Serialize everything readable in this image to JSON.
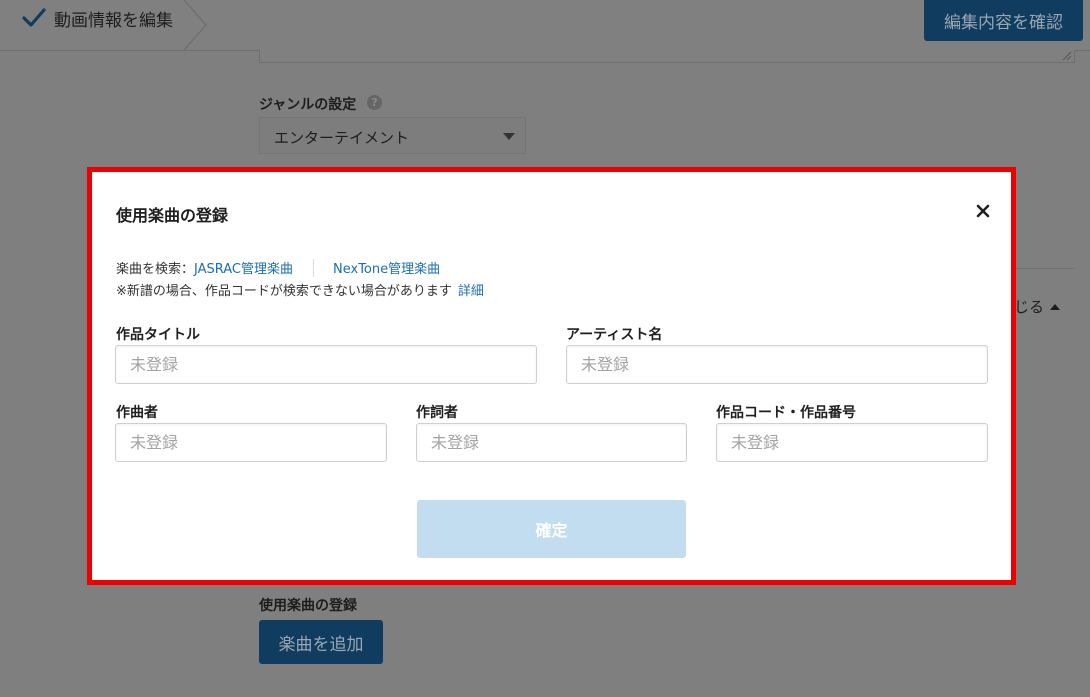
{
  "header": {
    "breadcrumb_label": "動画情報を編集",
    "confirm_button_label": "編集内容を確認"
  },
  "page": {
    "genre_label": "ジャンルの設定",
    "genre_help": "?",
    "genre_value": "エンターテイメント",
    "collapse_toggle_label": "じる",
    "music_section_label": "使用楽曲の登録",
    "add_music_button_label": "楽曲を追加"
  },
  "modal": {
    "title": "使用楽曲の登録",
    "search_prefix": "楽曲を検索：",
    "jasrac_link": "JASRAC管理楽曲",
    "nextone_link": "NexTone管理楽曲",
    "note_text": "※新譜の場合、作品コードが検索できない場合があります",
    "detail_link": "詳細",
    "fields": {
      "title": {
        "label": "作品タイトル",
        "placeholder": "未登録",
        "value": ""
      },
      "artist": {
        "label": "アーティスト名",
        "placeholder": "未登録",
        "value": ""
      },
      "composer": {
        "label": "作曲者",
        "placeholder": "未登録",
        "value": ""
      },
      "lyricist": {
        "label": "作詞者",
        "placeholder": "未登録",
        "value": ""
      },
      "work_code": {
        "label": "作品コード・作品番号",
        "placeholder": "未登録",
        "value": ""
      }
    },
    "ok_button_label": "確定"
  },
  "colors": {
    "overlay_bg": "#7f7f7f",
    "primary_dark": "#0f3c5f",
    "link": "#1a6eb5",
    "modal_highlight_border": "#ee0000",
    "ok_button_disabled": "#c2ddef"
  },
  "icons": [
    "check-icon",
    "help-icon",
    "caret-down-icon",
    "caret-up-icon",
    "close-icon",
    "resize-icon"
  ]
}
